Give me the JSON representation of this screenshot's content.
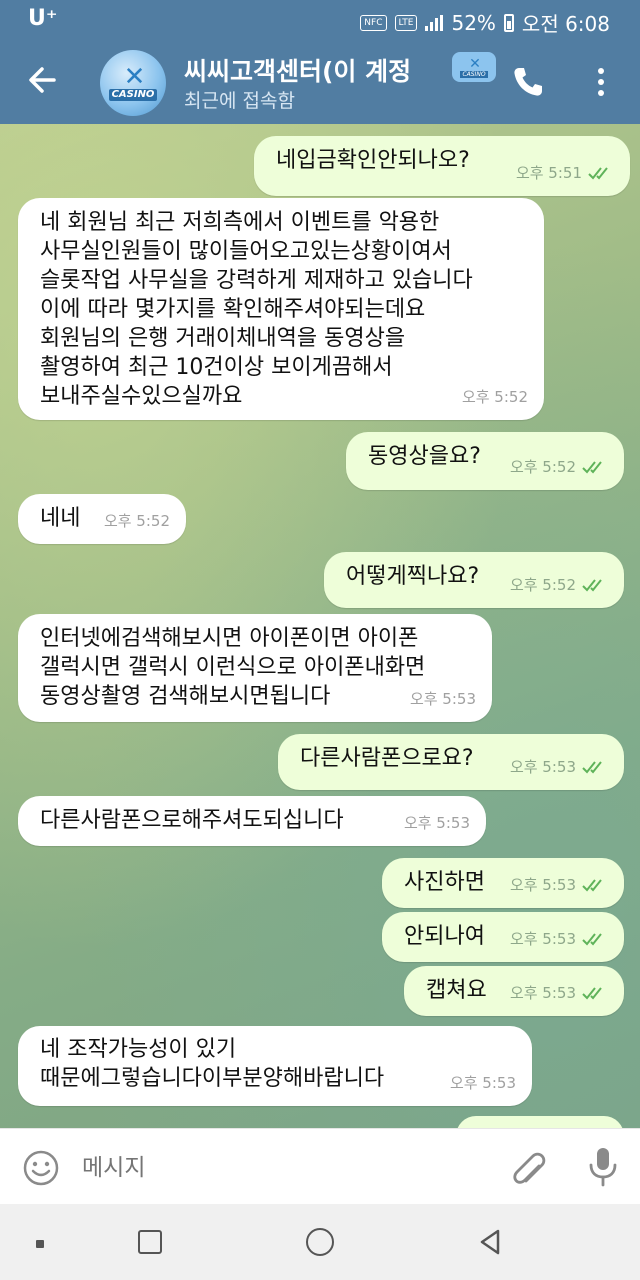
{
  "status_bar": {
    "carrier": "U⁺",
    "nfc_label": "NFC",
    "lte_label": "LTE",
    "battery": "52%",
    "time": "오전 6:08"
  },
  "header": {
    "title": "씨씨고객센터(이 계정",
    "subtitle": "최근에 접속함",
    "avatar_mark": "✕",
    "avatar_text": "CASINO",
    "badge_mark": "✕",
    "badge_text": "CASINO"
  },
  "messages": [
    {
      "dir": "out",
      "text": "네입금확인안되나오?",
      "time": "오후 5:51"
    },
    {
      "dir": "in",
      "text": "네 회원님 최근 저희측에서 이벤트를 악용한\n사무실인원들이 많이들어오고있는상황이여서\n슬롯작업 사무실을 강력하게 제재하고 있습니다\n이에 따라 몇가지를 확인해주셔야되는데요\n회원님의 은행 거래이체내역을 동영상을\n촬영하여 최근 10건이상 보이게끔해서\n보내주실수있으실까요",
      "time": "오후 5:52"
    },
    {
      "dir": "out",
      "text": "동영상을요?",
      "time": "오후 5:52"
    },
    {
      "dir": "in",
      "text": "네네",
      "time": "오후 5:52"
    },
    {
      "dir": "out",
      "text": "어떻게찍나요?",
      "time": "오후 5:52"
    },
    {
      "dir": "in",
      "text": "인터넷에검색해보시면 아이폰이면 아이폰\n갤럭시면 갤럭시 이런식으로 아이폰내화면\n동영상촬영 검색해보시면됩니다",
      "time": "오후 5:53"
    },
    {
      "dir": "out",
      "text": "다른사람폰으로요?",
      "time": "오후 5:53"
    },
    {
      "dir": "in",
      "text": "다른사람폰으로해주셔도되십니다",
      "time": "오후 5:53"
    },
    {
      "dir": "out",
      "text": "사진하면",
      "time": "오후 5:53"
    },
    {
      "dir": "out",
      "text": "안되나여",
      "time": "오후 5:53"
    },
    {
      "dir": "out",
      "text": "캡쳐요",
      "time": "오후 5:53"
    },
    {
      "dir": "in",
      "text": "네 조작가능성이 있기\n때문에그렇습니다이부분양해바랍니다",
      "time": "오후 5:53"
    }
  ],
  "input": {
    "placeholder": "메시지"
  },
  "colors": {
    "header": "#517da2",
    "outgoing_bubble": "#eefed9",
    "incoming_bubble": "#ffffff",
    "read_ticks": "#5fb35a"
  },
  "icons": [
    "back-arrow-icon",
    "phone-icon",
    "more-vert-icon",
    "emoji-icon",
    "paperclip-icon",
    "microphone-icon",
    "double-check-icon"
  ]
}
